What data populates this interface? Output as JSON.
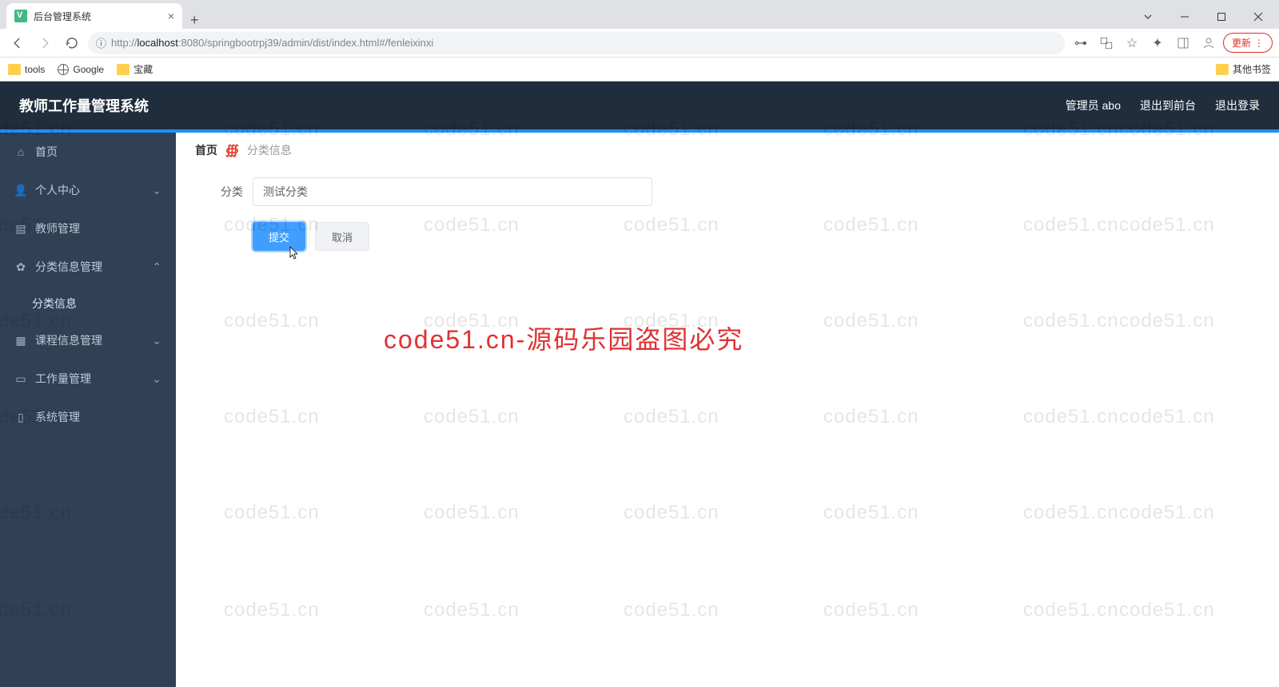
{
  "browser": {
    "tab_title": "后台管理系统",
    "url_prefix": "http://",
    "url_host": "localhost",
    "url_rest": ":8080/springbootrpj39/admin/dist/index.html#/fenleixinxi",
    "update_label": "更新",
    "bookmarks": {
      "tools": "tools",
      "google": "Google",
      "treasure": "宝藏",
      "others": "其他书签"
    }
  },
  "header": {
    "title": "教师工作量管理系统",
    "user": "管理员 abo",
    "exit_front": "退出到前台",
    "logout": "退出登录"
  },
  "sidebar": {
    "home": "首页",
    "personal": "个人中心",
    "teacher": "教师管理",
    "category_mgmt": "分类信息管理",
    "category_info": "分类信息",
    "course": "课程信息管理",
    "workload": "工作量管理",
    "system": "系统管理"
  },
  "breadcrumb": {
    "home": "首页",
    "current": "分类信息"
  },
  "form": {
    "label_category": "分类",
    "value_category": "测试分类",
    "submit": "提交",
    "cancel": "取消"
  },
  "watermark": {
    "text": "code51.cn",
    "red": "code51.cn-源码乐园盗图必究"
  }
}
